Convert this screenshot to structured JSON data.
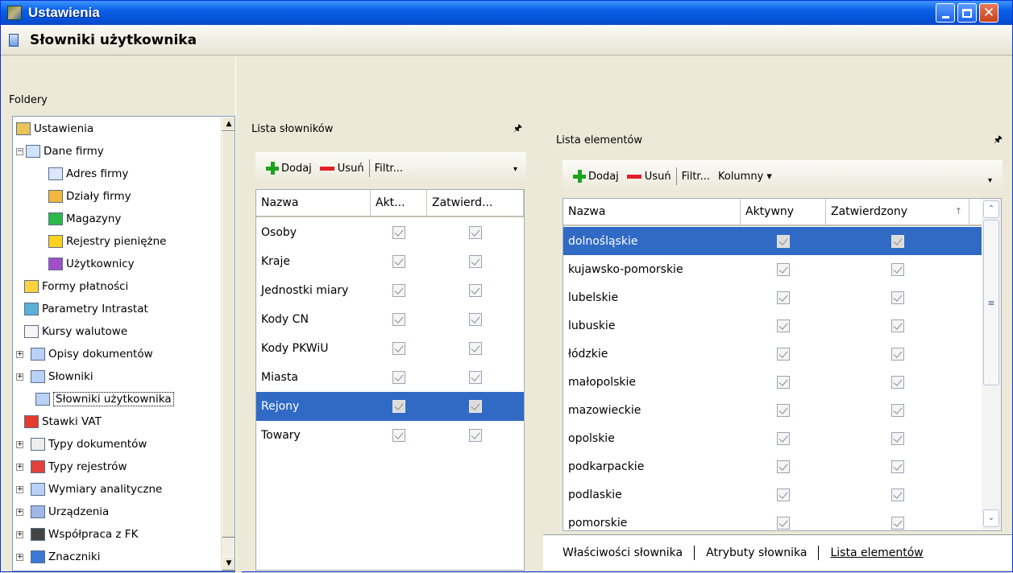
{
  "window": {
    "title": "Ustawienia"
  },
  "subheader": {
    "title": "Słowniki użytkownika"
  },
  "folders": {
    "label": "Foldery",
    "tree": [
      {
        "label": "Ustawienia",
        "icon": "settings-icon"
      },
      {
        "label": "Dane firmy",
        "icon": "house-icon"
      },
      {
        "label": "Adres firmy",
        "icon": "envelope-icon"
      },
      {
        "label": "Działy firmy",
        "icon": "people-icon"
      },
      {
        "label": "Magazyny",
        "icon": "warehouse-icon"
      },
      {
        "label": "Rejestry pieniężne",
        "icon": "coins-icon"
      },
      {
        "label": "Użytkownicy",
        "icon": "users-icon"
      },
      {
        "label": "Formy płatności",
        "icon": "payment-icon"
      },
      {
        "label": "Parametry Intrastat",
        "icon": "intrastat-icon"
      },
      {
        "label": "Kursy walutowe",
        "icon": "chart-icon"
      },
      {
        "label": "Opisy dokumentów",
        "icon": "document-icon"
      },
      {
        "label": "Słowniki",
        "icon": "document-icon"
      },
      {
        "label": "Słowniki użytkownika",
        "icon": "document-icon"
      },
      {
        "label": "Stawki VAT",
        "icon": "vat-icon"
      },
      {
        "label": "Typy dokumentów",
        "icon": "doc-types-icon"
      },
      {
        "label": "Typy rejestrów",
        "icon": "grid-icon"
      },
      {
        "label": "Wymiary analityczne",
        "icon": "document-icon"
      },
      {
        "label": "Urządzenia",
        "icon": "device-icon"
      },
      {
        "label": "Współpraca z FK",
        "icon": "handshake-icon"
      },
      {
        "label": "Znaczniki",
        "icon": "tags-icon"
      }
    ]
  },
  "dict_list": {
    "title": "Lista słowników",
    "toolbar": {
      "add": "Dodaj",
      "remove": "Usuń",
      "filter": "Filtr..."
    },
    "columns": [
      "Nazwa",
      "Akt...",
      "Zatwierd..."
    ],
    "rows": [
      {
        "name": "Osoby"
      },
      {
        "name": "Kraje"
      },
      {
        "name": "Jednostki miary"
      },
      {
        "name": "Kody CN"
      },
      {
        "name": "Kody PKWiU"
      },
      {
        "name": "Miasta"
      },
      {
        "name": "Rejony"
      },
      {
        "name": "Towary"
      }
    ],
    "selected_index": 6
  },
  "element_list": {
    "title": "Lista elementów",
    "toolbar": {
      "add": "Dodaj",
      "remove": "Usuń",
      "filter": "Filtr...",
      "columns": "Kolumny"
    },
    "columns": [
      "Nazwa",
      "Aktywny",
      "Zatwierdzony"
    ],
    "rows": [
      {
        "name": "dolnośląskie"
      },
      {
        "name": "kujawsko-pomorskie"
      },
      {
        "name": "lubelskie"
      },
      {
        "name": "lubuskie"
      },
      {
        "name": "łódzkie"
      },
      {
        "name": "małopolskie"
      },
      {
        "name": "mazowieckie"
      },
      {
        "name": "opolskie"
      },
      {
        "name": "podkarpackie"
      },
      {
        "name": "podlaskie"
      },
      {
        "name": "pomorskie"
      }
    ],
    "selected_index": 0
  },
  "tabs": [
    "Właściwości słownika",
    "Atrybuty słownika",
    "Lista elementów"
  ],
  "active_tab": 2,
  "colors": {
    "titlebar": "#0a5fe4",
    "selection": "#316ac5"
  }
}
